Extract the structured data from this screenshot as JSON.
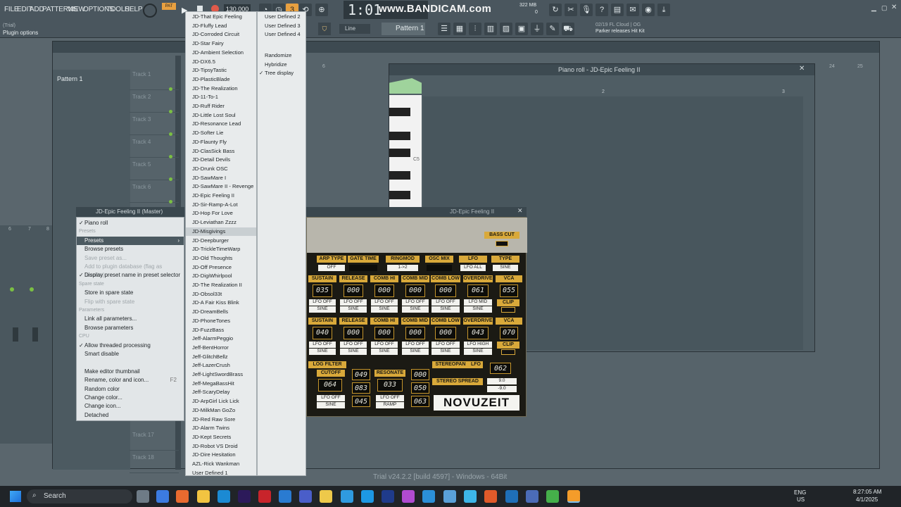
{
  "menubar": {
    "file": "FILE",
    "edit": "EDIT",
    "add": "ADD",
    "patterns": "PATTERNS",
    "view": "VIEW",
    "options": "OPTIONS",
    "tools": "TOOLS",
    "help": "HELP"
  },
  "hint": {
    "trial": "(Trial)",
    "plugin_options": "Plugin options"
  },
  "transport": {
    "pat": "PAT",
    "song": "SONG",
    "tempo": "130.000",
    "time": "1:01",
    "bst": "B:S:T"
  },
  "watermark": "www.BANDICAM.com",
  "memory": {
    "mb": "322 MB",
    "num": "0"
  },
  "toolbar2": {
    "snap": "Line",
    "pattern": "Pattern 1"
  },
  "news": {
    "line1": "02/19  FL Cloud | OG",
    "line2": "Parker releases Hit Kit"
  },
  "playlist": {
    "pattern_item": "Pattern 1",
    "tracks": [
      "Track 1",
      "Track 2",
      "Track 3",
      "Track 4",
      "Track 5",
      "Track 6",
      "Track 17",
      "Track 18"
    ],
    "bar_numbers": [
      "6",
      "7",
      "8"
    ]
  },
  "channel_window": {
    "title": "JD-Epic Feeling II (Master)"
  },
  "context_menu": {
    "items": [
      {
        "label": "Piano roll",
        "checked": true,
        "state": "normal"
      },
      {
        "label": "Presets",
        "state": "head"
      },
      {
        "label": "Presets",
        "state": "highlight",
        "arrow": "›"
      },
      {
        "label": "Browse presets",
        "state": "normal"
      },
      {
        "label": "Save preset as...",
        "state": "disabled"
      },
      {
        "label": "Add to plugin database (flag as favorite)",
        "state": "disabled"
      },
      {
        "label": "Display preset name in preset selector",
        "checked": true,
        "state": "normal"
      },
      {
        "label": "Spare state",
        "state": "head"
      },
      {
        "label": "Store in spare state",
        "state": "normal"
      },
      {
        "label": "Flip with spare state",
        "state": "disabled"
      },
      {
        "label": "Parameters",
        "state": "head"
      },
      {
        "label": "Link all parameters...",
        "state": "normal"
      },
      {
        "label": "Browse parameters",
        "state": "normal"
      },
      {
        "label": "CPU",
        "state": "head"
      },
      {
        "label": "Allow threaded processing",
        "checked": true,
        "state": "normal"
      },
      {
        "label": "Smart disable",
        "state": "normal"
      },
      {
        "label": "",
        "state": "head"
      },
      {
        "label": "Make editor thumbnail",
        "state": "normal"
      },
      {
        "label": "Rename, color and icon...",
        "shortcut": "F2",
        "state": "normal"
      },
      {
        "label": "Random color",
        "state": "normal"
      },
      {
        "label": "Change color...",
        "state": "normal"
      },
      {
        "label": "Change icon...",
        "state": "normal"
      },
      {
        "label": "Detached",
        "state": "normal"
      }
    ]
  },
  "preset_list": [
    "JD-That Epic Feeling",
    "JD-Fluffy Lead",
    "JD-Corroded Circuit",
    "JD-Star Fairy",
    "JD-Ambient Selection",
    "JD-DX6.5",
    "JD-TipsyTastic",
    "JD-PlasticBlade",
    "JD-The Realization",
    "JD-11-To-1",
    "JD-Ruff Rider",
    "JD-Little Lost Soul",
    "JD-Resonance Lead",
    "JD-Softer Lie",
    "JD-Flaunty Fly",
    "JD-ClasSick Bass",
    "JD-Detail Devils",
    "JD-Drunk OSC",
    "JD-SawMare I",
    "JD-SawMare II - Revenge",
    "JD-Epic Feeling II",
    "JD-Sir-Ramp-A-Lot",
    "JD-Hop For Love",
    "JD-Leviathan Zzzz",
    "JD-Misgivings",
    "JD-Deepburger",
    "JD-TrickleTimeWarp",
    "JD-Old Thoughts",
    "JD-Off Presence",
    "JD-DigiWhirlpool",
    "JD-The Realization II",
    "JD-Obsol33t",
    "JD-A Fair Kiss Blink",
    "JD-DreamBells",
    "JD-PhoneTones",
    "JD-FuzzBass",
    "Jeff-AlarmPeggio",
    "Jeff-BentHorror",
    "Jeff-GlitchBellz",
    "Jeff-LazerCrush",
    "Jeff-LightSwordBrass",
    "Jeff-MegaBassHit",
    "Jeff-ScaryDelay",
    "JD-ArpGirl Lick Lick",
    "JD-MilkMan GoZo",
    "JD-Red Raw Sore",
    "JD-Alarm Twins",
    "JD-Kept Secrets",
    "JD-Robot VS Droid",
    "JD-Dire Hesitation",
    "AZL-Rick Wankman",
    "User Defined 1"
  ],
  "preset_highlight_index": 24,
  "submenu": [
    {
      "label": "User Defined 2"
    },
    {
      "label": "User Defined 3"
    },
    {
      "label": "User Defined 4"
    },
    {
      "label": ""
    },
    {
      "label": "Randomize"
    },
    {
      "label": "Hybridize"
    },
    {
      "label": "Tree display",
      "checked": true
    }
  ],
  "piano_roll": {
    "title": "Piano roll - JD-Epic Feeling II",
    "note_c5": "C5",
    "bars": [
      "2",
      "3"
    ],
    "top_nums": [
      "6",
      "24",
      "25"
    ]
  },
  "plugin": {
    "title": "JD-Epic Feeling II",
    "bass_cut": "BASS CUT",
    "row0_headers": [
      "ARP TYPE",
      "GATE TIME",
      "RINGMOD",
      "OSC MIX",
      "LFO",
      "TYPE"
    ],
    "row0_values": [
      "OFF",
      "",
      "1->2",
      "",
      "LFO ALL",
      "SINE"
    ],
    "row1_headers": [
      "SUSTAIN",
      "RELEASE",
      "COMB HI",
      "COMB MID",
      "COMB LOW",
      "OVERDRIVE",
      "VCA"
    ],
    "row1_lcd": [
      "035",
      "000",
      "000",
      "000",
      "000",
      "061",
      "055"
    ],
    "row1_lfo": [
      "LFO OFF",
      "LFO OFF",
      "LFO OFF",
      "LFO OFF",
      "LFO OFF",
      "LFO MID"
    ],
    "row1_wave": [
      "SINE",
      "SINE",
      "SINE",
      "SINE",
      "SINE",
      "SINE"
    ],
    "clip": "CLIP",
    "row2_headers": [
      "SUSTAIN",
      "RELEASE",
      "COMB HI",
      "COMB MID",
      "COMB LOW",
      "OVERDRIVE",
      "VCA"
    ],
    "row2_lcd": [
      "040",
      "000",
      "000",
      "000",
      "000",
      "043",
      "070"
    ],
    "row2_lfo": [
      "LFO OFF",
      "LFO OFF",
      "LFO OFF",
      "LFO OFF",
      "LFO OFF",
      "LFO HIGH"
    ],
    "row2_wave": [
      "SINE",
      "SINE",
      "SINE",
      "SINE",
      "SINE",
      "SINE"
    ],
    "filter_head": "LOG FILTER",
    "cutoff": "CUTOFF",
    "cutoff_val": "064",
    "filter_a": "049",
    "filter_b": "083",
    "filter_c": "045",
    "resonate": "RESONATE",
    "resonate_val": "033",
    "res_lfo": "LFO OFF",
    "res_wave": "RAMP",
    "cut_lfo": "LFO OFF",
    "cut_wave": "SINE",
    "d1": "000",
    "d2": "050",
    "d3": "063",
    "stereopan": "STEREOPAN",
    "lfo": "LFO",
    "stereo_spread": "STEREO SPREAD",
    "pan_val": "062",
    "spread_a": "9.0",
    "spread_b": "-9.0",
    "brand": "NOVUZEIT"
  },
  "version": "Trial v24.2.2 [build 4597] - Windows - 64Bit",
  "taskbar": {
    "search": "Search",
    "lang1": "ENG",
    "lang2": "US",
    "time": "8:27:05 AM",
    "date": "4/1/2025"
  },
  "colors": {
    "accent_green": "#7bc043",
    "plugin_gold": "#d9a93a",
    "highlight": "#4b5960"
  }
}
